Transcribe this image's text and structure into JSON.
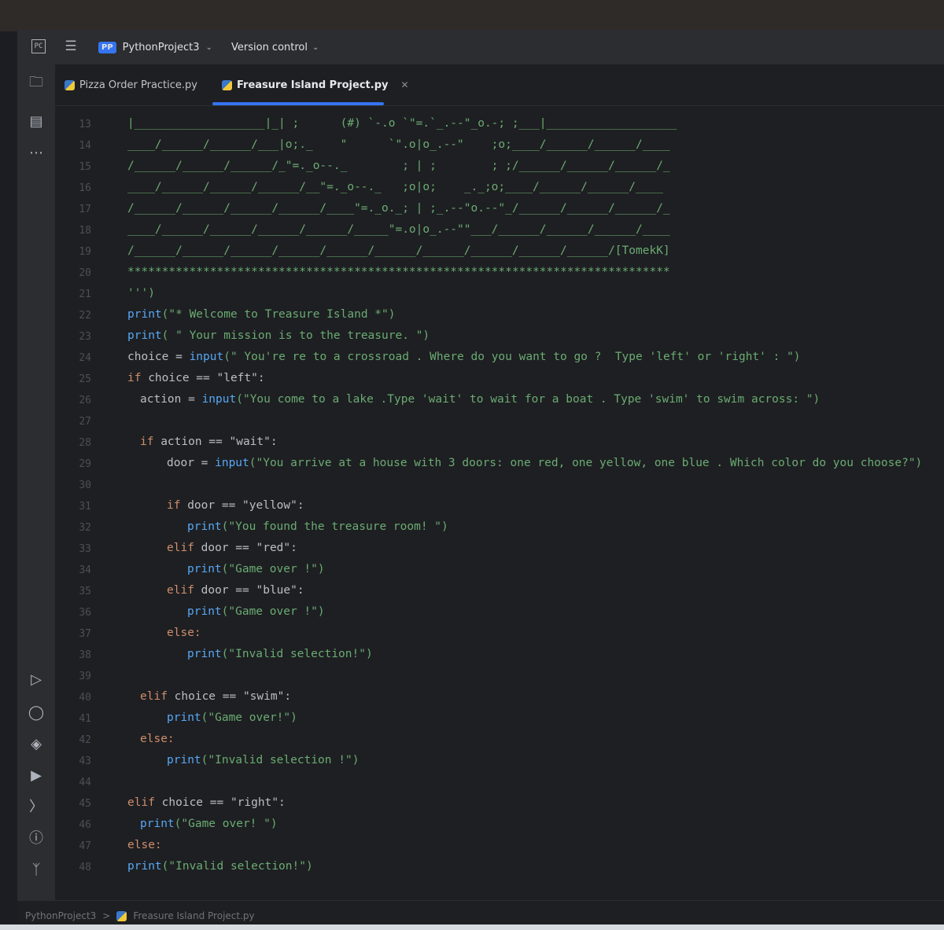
{
  "titlebar": {
    "project_badge": "PP",
    "project_name": "PythonProject3",
    "vcs_label": "Version control"
  },
  "tabs": [
    {
      "label": "Pizza Order Practice.py",
      "active": false
    },
    {
      "label": "Freasure Island Project.py",
      "active": true
    }
  ],
  "editor": {
    "line_numbers": [
      "13",
      "14",
      "15",
      "16",
      "17",
      "18",
      "19",
      "20",
      "21",
      "22",
      "23",
      "24",
      "25",
      "26",
      "27",
      "28",
      "29",
      "30",
      "31",
      "32",
      "33",
      "34",
      "35",
      "36",
      "37",
      "38",
      "39",
      "40",
      "41",
      "42",
      "43",
      "44",
      "45",
      "46",
      "47",
      "48"
    ],
    "ascii_art": [
      "|___________________|_| ;      (#) `-.o `\"=.`_.--\"_o.-; ;___|___________________",
      "____/______/______/___|o;._    \"      `\".o|o_.--\"    ;o;____/______/______/____",
      "/______/______/______/_\"=._o--._        ; | ;        ; ;/______/______/______/_",
      "____/______/______/______/__\"=._o--._   ;o|o;    _._;o;____/______/______/____",
      "/______/______/______/______/____\"=._o._; | ;_.--\"o.--\"_/______/______/______/_",
      "____/______/______/______/______/_____\"=.o|o_.--\"\"___/______/______/______/____",
      "/______/______/______/______/______/______/______/______/______/______/[TomekK]",
      "*******************************************************************************",
      "''')"
    ],
    "lines": {
      "l22": {
        "fn": "print",
        "rest": "(\"* Welcome to Treasure Island *\")"
      },
      "l23": {
        "fn": "print",
        "rest": "( \" Your mission is to the treasure. \")"
      },
      "l24": {
        "pre": "choice = ",
        "fn": "input",
        "rest": "(\" You're re to a crossroad . Where do you want to go ?  Type 'left' or 'right' : \")"
      },
      "l25": {
        "kw": "if",
        "rest": " choice == \"left\":"
      },
      "l26": {
        "pre": "action = ",
        "fn": "input",
        "rest": "(\"You come to a lake .Type 'wait' to wait for a boat . Type 'swim' to swim across: \")"
      },
      "l28": {
        "kw": "if",
        "rest": " action == \"wait\":"
      },
      "l29": {
        "pre": "door = ",
        "fn": "input",
        "rest": "(\"You arrive at a house with 3 doors: one red, one yellow, one blue . Which color do you choose?\")"
      },
      "l31": {
        "kw": "if",
        "rest": " door == \"yellow\":"
      },
      "l32": {
        "fn": "print",
        "rest": "(\"You found the treasure room! \")"
      },
      "l33": {
        "kw": "elif",
        "rest": " door == \"red\":"
      },
      "l34": {
        "fn": "print",
        "rest": "(\"Game over !\")"
      },
      "l35": {
        "kw": "elif",
        "rest": " door == \"blue\":"
      },
      "l36": {
        "fn": "print",
        "rest": "(\"Game over !\")"
      },
      "l37": {
        "kw": "else:"
      },
      "l38": {
        "fn": "print",
        "rest": "(\"Invalid selection!\")"
      },
      "l40": {
        "kw": "elif",
        "rest": " choice == \"swim\":"
      },
      "l41": {
        "fn": "print",
        "rest": "(\"Game over!\")"
      },
      "l42": {
        "kw": "else:"
      },
      "l43": {
        "fn": "print",
        "rest": "(\"Invalid selection !\")"
      },
      "l45": {
        "kw": "elif",
        "rest": " choice == \"right\":"
      },
      "l46": {
        "fn": "print",
        "rest": "(\"Game over! \")"
      },
      "l47": {
        "kw": "else:"
      },
      "l48": {
        "fn": "print",
        "rest": "(\"Invalid selection!\")"
      }
    }
  },
  "breadcrumb": {
    "project": "PythonProject3",
    "separator": ">",
    "file": "Freasure Island Project.py"
  },
  "colors": {
    "accent": "#3574f0",
    "keyword": "#cf8e6d",
    "function": "#56a8f5",
    "string": "#6aab73"
  }
}
